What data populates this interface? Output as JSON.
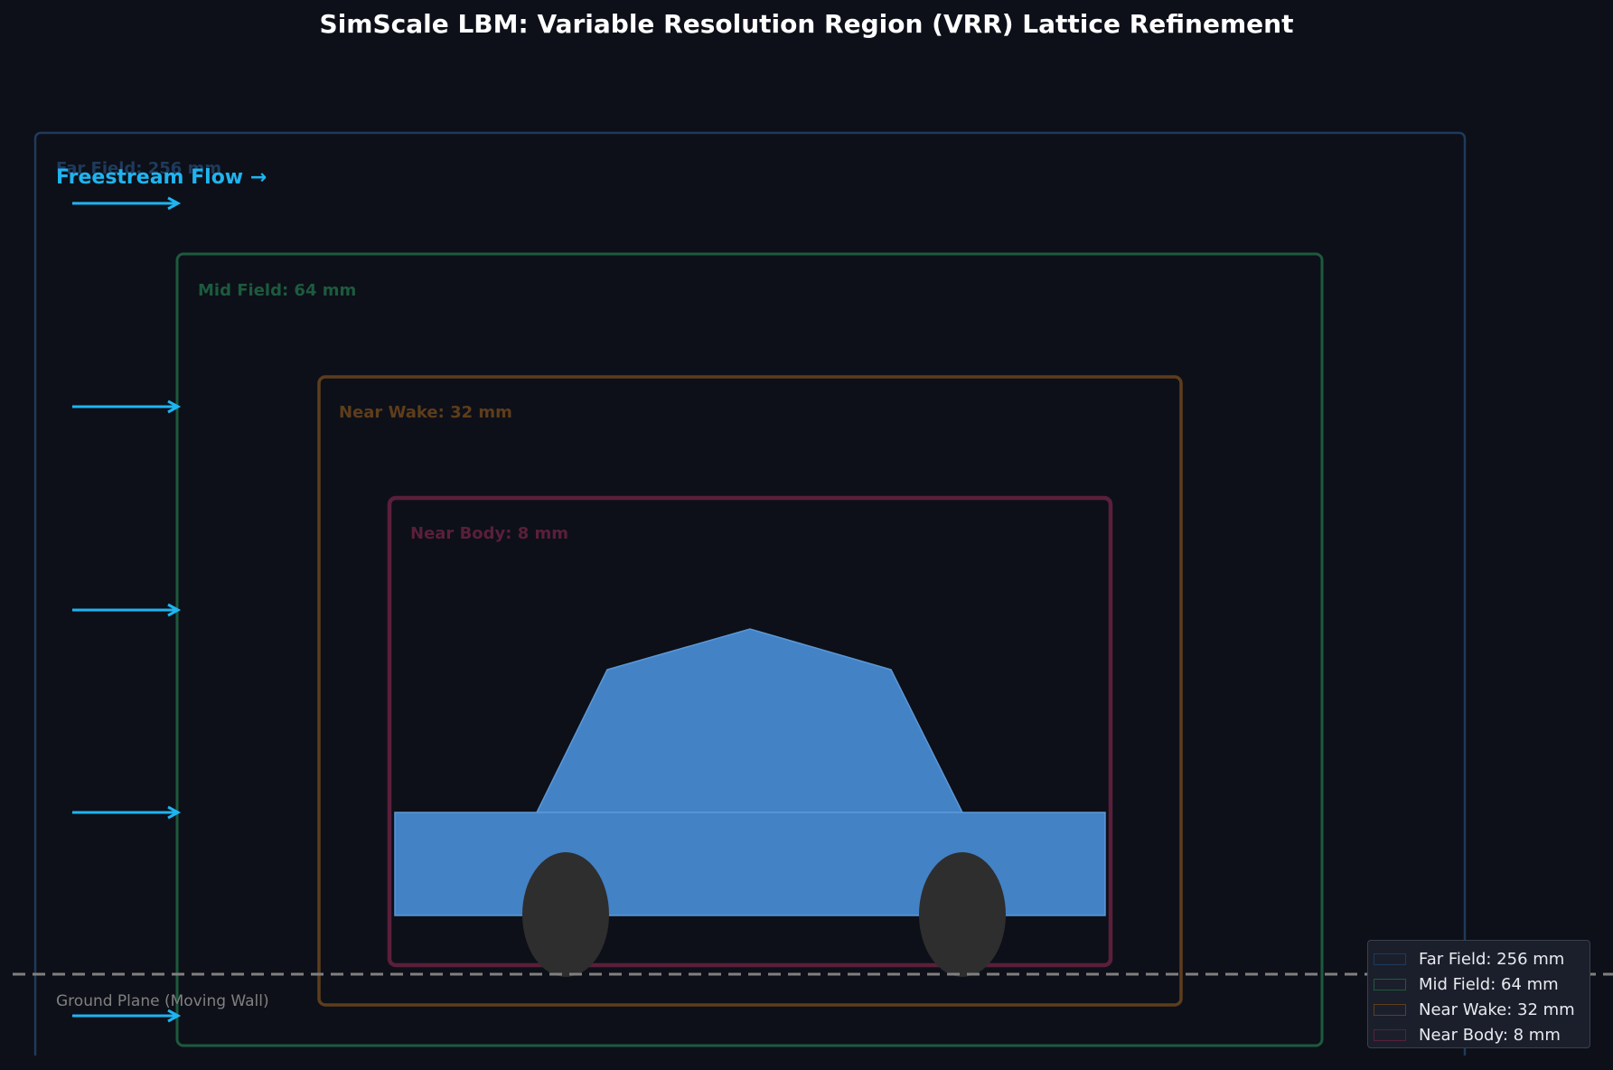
{
  "title": "SimScale LBM: Variable Resolution Region (VRR) Lattice Refinement",
  "flow": {
    "label": "Freestream Flow →",
    "arrow_count": 5,
    "color": "#1fb4f0"
  },
  "zones": [
    {
      "label": "Far Field: 256 mm",
      "color": "#1f3a5c"
    },
    {
      "label": "Mid Field: 64 mm",
      "color": "#1d5a3e"
    },
    {
      "label": "Near Wake: 32 mm",
      "color": "#5e3d1c"
    },
    {
      "label": "Near Body: 8 mm",
      "color": "#5a1f3a"
    }
  ],
  "vehicle": {
    "body_color": "#4482c6",
    "wheel_color": "#2e2e2e"
  },
  "ground": {
    "label": "Ground Plane (Moving Wall)",
    "color": "#808080"
  },
  "legend": {
    "position": "bottom-right",
    "items": [
      {
        "label": "Far Field: 256 mm",
        "color": "#1f3a5c"
      },
      {
        "label": "Mid Field: 64 mm",
        "color": "#1d5a3e"
      },
      {
        "label": "Near Wake: 32 mm",
        "color": "#5e3d1c"
      },
      {
        "label": "Near Body: 8 mm",
        "color": "#5a1f3a"
      }
    ]
  },
  "background_color": "#0d1018"
}
